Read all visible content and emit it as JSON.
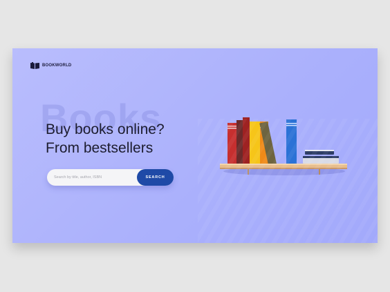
{
  "brand": {
    "name": "BOOKWORLD",
    "icon": "open-book-icon"
  },
  "hero": {
    "watermark": "Books",
    "headline_line1": "Buy books online?",
    "headline_line2": "From bestsellers"
  },
  "search": {
    "placeholder": "Search by title, author, ISBN",
    "button_label": "SEARCH"
  },
  "colors": {
    "background": "#aab0fc",
    "accent": "#1f4aa7",
    "text": "#1d1d2f"
  },
  "illustration": {
    "icon": "bookshelf-icon"
  }
}
